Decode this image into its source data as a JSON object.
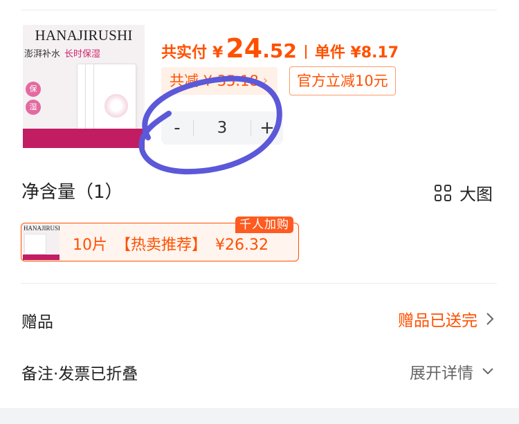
{
  "product": {
    "brand": "HANAJIRUSHI",
    "tag_left": "澎湃补水",
    "tag_right": "长时保湿",
    "seal_1": "保",
    "seal_2": "湿"
  },
  "price": {
    "total_label": "共实付",
    "yen": "¥",
    "total_int": "24",
    "total_dec": ".52",
    "unit_text": "单件 ¥8.17"
  },
  "discount": {
    "saved_text": "共减 ¥ 35.18",
    "official_text": "官方立减10元"
  },
  "quantity": {
    "minus": "-",
    "value": "3",
    "plus": "+"
  },
  "spec": {
    "title": "净含量（1）",
    "big_view_label": "大图",
    "option": {
      "thumb_brand": "HANAJIRUSHI",
      "size": "10片",
      "tag": "【热卖推荐】",
      "price": "¥26.32",
      "badge": "千人加购"
    }
  },
  "gift": {
    "label": "赠品",
    "value": "赠品已送完"
  },
  "remark": {
    "label": "备注·发票已折叠",
    "value": "展开详情"
  },
  "colors": {
    "accent": "#ff5000",
    "annotation": "#5b58d9",
    "product_magenta": "#c21d63"
  }
}
